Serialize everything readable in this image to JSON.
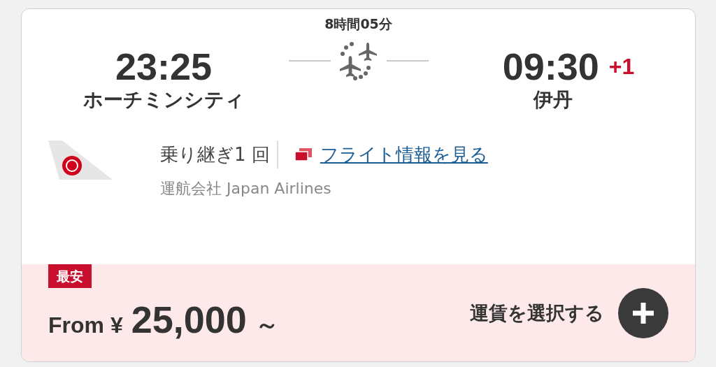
{
  "departure": {
    "time": "23:25",
    "city": "ホーチミンシティ"
  },
  "duration": "8時間05分",
  "arrival": {
    "time": "09:30",
    "day_offset": "+1",
    "city": "伊丹"
  },
  "stops": "乗り継ぎ1 回",
  "flight_info_link": "フライト情報を見る",
  "operator": "運航会社 Japan Airlines",
  "fare": {
    "badge": "最安",
    "prefix": "From ¥",
    "amount": "25,000",
    "suffix": "～",
    "select_label": "運賃を選択する"
  }
}
